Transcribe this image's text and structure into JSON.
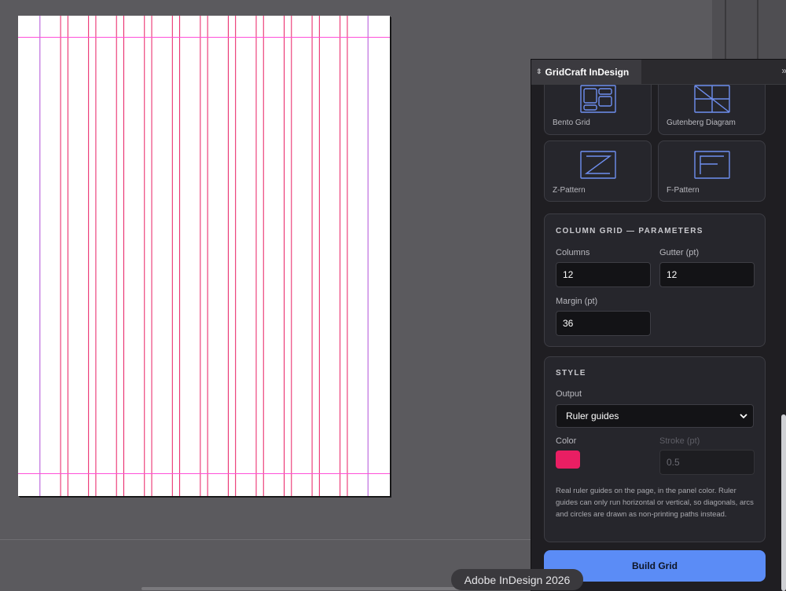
{
  "panel": {
    "title": "GridCraft InDesign",
    "collapse_glyph": "»",
    "grip_icon": "double-arrow-icon"
  },
  "presets": [
    {
      "label": "Bento Grid",
      "icon": "bento-grid-icon"
    },
    {
      "label": "Gutenberg Diagram",
      "icon": "gutenberg-diagram-icon"
    },
    {
      "label": "Z-Pattern",
      "icon": "z-pattern-icon"
    },
    {
      "label": "F-Pattern",
      "icon": "f-pattern-icon"
    }
  ],
  "parameters": {
    "heading": "COLUMN GRID — PARAMETERS",
    "columns_label": "Columns",
    "columns_value": "12",
    "gutter_label": "Gutter (pt)",
    "gutter_value": "12",
    "margin_label": "Margin (pt)",
    "margin_value": "36"
  },
  "style": {
    "heading": "STYLE",
    "output_label": "Output",
    "output_value": "Ruler guides",
    "color_label": "Color",
    "color_hex": "#e91e63",
    "stroke_label": "Stroke (pt)",
    "stroke_placeholder": "0.5",
    "note": "Real ruler guides on the page, in the panel color. Ruler guides can only run horizontal or vertical, so diagonals, arcs and circles are drawn as non-printing paths instead."
  },
  "build_button": "Build Grid",
  "toast": "Adobe InDesign 2026",
  "colors": {
    "guide": "#e91e63",
    "margin_guide": "#ff4fd8",
    "accent": "#5b8cf6",
    "icon": "#6f8ff0"
  },
  "document": {
    "page_width_pt": 612,
    "page_height_pt": 792,
    "margin_pt": 36,
    "columns": 12,
    "gutter_pt": 12
  }
}
